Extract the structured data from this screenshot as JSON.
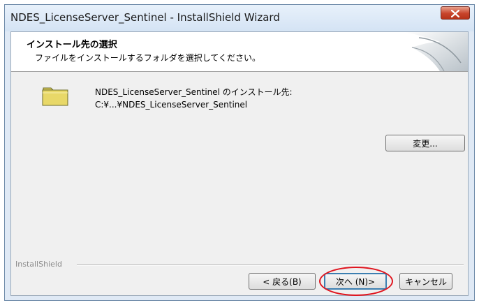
{
  "window": {
    "title": "NDES_LicenseServer_Sentinel - InstallShield Wizard",
    "close_icon": "close-icon"
  },
  "header": {
    "title": "インストール先の選択",
    "subtitle": "ファイルをインストールするフォルダを選択してください。"
  },
  "destination": {
    "folder_icon": "folder-icon",
    "label": "NDES_LicenseServer_Sentinel のインストール先:",
    "path": "C:¥...¥NDES_LicenseServer_Sentinel",
    "change_label": "変更..."
  },
  "footer": {
    "brand": "InstallShield",
    "back_label": "< 戻る(B)",
    "next_label": "次へ (N)>",
    "cancel_label": "キャンセル"
  },
  "colors": {
    "highlight": "#e0141e",
    "close_button": "#c8442b",
    "folder": "#f0e68c"
  }
}
